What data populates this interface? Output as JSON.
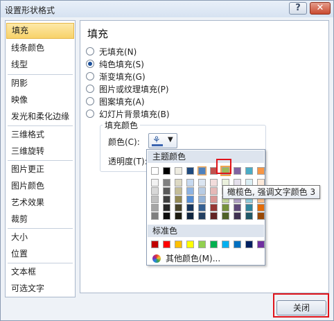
{
  "window": {
    "title": "设置形状格式",
    "help_glyph": "?",
    "close_glyph": "✕"
  },
  "sidebar": {
    "items": [
      {
        "label": "填充",
        "selected": true
      },
      {
        "label": "线条颜色"
      },
      {
        "label": "线型"
      },
      {
        "label": "阴影"
      },
      {
        "label": "映像"
      },
      {
        "label": "发光和柔化边缘"
      },
      {
        "label": "三维格式"
      },
      {
        "label": "三维旋转"
      },
      {
        "label": "图片更正"
      },
      {
        "label": "图片颜色"
      },
      {
        "label": "艺术效果"
      },
      {
        "label": "裁剪"
      },
      {
        "label": "大小"
      },
      {
        "label": "位置"
      },
      {
        "label": "文本框"
      },
      {
        "label": "可选文字"
      }
    ]
  },
  "content": {
    "heading": "填充",
    "options": [
      {
        "label": "无填充(N)",
        "checked": false
      },
      {
        "label": "纯色填充(S)",
        "checked": true
      },
      {
        "label": "渐变填充(G)",
        "checked": false
      },
      {
        "label": "图片或纹理填充(P)",
        "checked": false
      },
      {
        "label": "图案填充(A)",
        "checked": false
      },
      {
        "label": "幻灯片背景填充(B)",
        "checked": false
      }
    ],
    "fill_color_group": {
      "title": "填充颜色",
      "color_label": "颜色(C):",
      "transparency_label": "透明度(T):",
      "color_button_icon": "paint-bucket-icon",
      "dropdown_glyph": "▼"
    }
  },
  "color_popup": {
    "theme_header": "主题颜色",
    "standard_header": "标准色",
    "more_colors_label": "其他颜色(M)...",
    "theme_colors": [
      "#FFFFFF",
      "#000000",
      "#EEECE1",
      "#1F497D",
      "#4F81BD",
      "#C0504D",
      "#9BBB59",
      "#8064A2",
      "#4BACC6",
      "#F79646"
    ],
    "theme_shades": [
      [
        "#F2F2F2",
        "#808080",
        "#DDD9C3",
        "#C6D9F0",
        "#DBE5F1",
        "#F2DCDB",
        "#EBF1DD",
        "#E5E0EC",
        "#DBEEF3",
        "#FDEADA"
      ],
      [
        "#D8D8D8",
        "#595959",
        "#C4BD97",
        "#8DB3E2",
        "#B8CCE4",
        "#E5B9B7",
        "#D7E3BC",
        "#CCC1D9",
        "#B7DDE8",
        "#FBD5B5"
      ],
      [
        "#BFBFBF",
        "#3F3F3F",
        "#938953",
        "#548DD4",
        "#95B3D7",
        "#D99694",
        "#C3D69B",
        "#B2A2C7",
        "#92CDDC",
        "#FAC08F"
      ],
      [
        "#A5A5A5",
        "#262626",
        "#494429",
        "#17365D",
        "#366092",
        "#953734",
        "#76923C",
        "#5F497A",
        "#31859B",
        "#E36C09"
      ],
      [
        "#7F7F7F",
        "#0C0C0C",
        "#1D1B10",
        "#0F243E",
        "#244061",
        "#632423",
        "#4F6128",
        "#3F3151",
        "#205867",
        "#974806"
      ]
    ],
    "standard_colors": [
      "#C00000",
      "#FF0000",
      "#FFC000",
      "#FFFF00",
      "#92D050",
      "#00B050",
      "#00B0F0",
      "#0070C0",
      "#002060",
      "#7030A0"
    ],
    "selected_theme_index": 4,
    "hovered_theme_index": 6
  },
  "tooltip": {
    "text": "橄榄色, 强调文字颜色 3"
  },
  "footer": {
    "close_label": "关闭"
  }
}
